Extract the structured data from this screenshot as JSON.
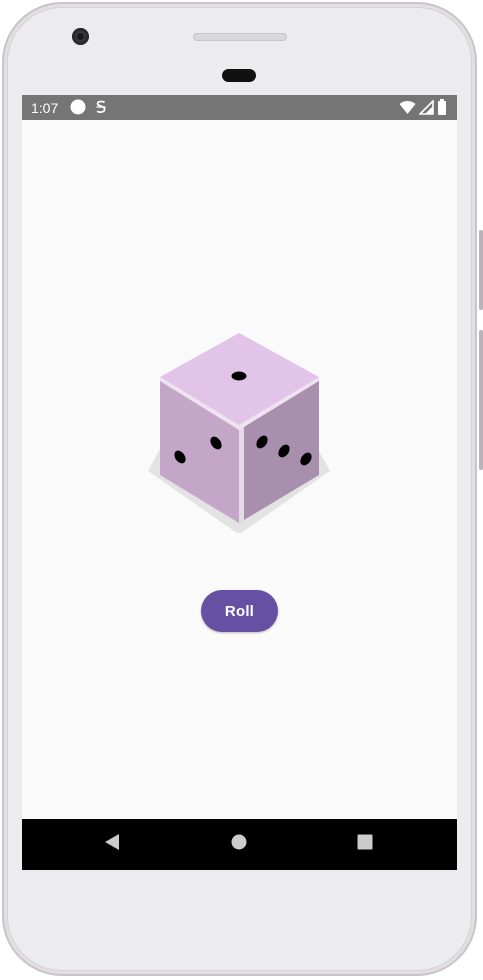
{
  "status_bar": {
    "time": "1:07",
    "left_icons": [
      "circle-notification-icon",
      "s-notification-icon"
    ],
    "right_icons": [
      "wifi-icon",
      "cellular-signal-icon",
      "battery-icon"
    ],
    "background": "#757575"
  },
  "app": {
    "background": "#fafafa",
    "dice": {
      "face_value_top": 1,
      "face_value_left": 2,
      "face_value_right": 3
    },
    "roll_button": {
      "label": "Roll",
      "color": "#6650a4"
    }
  },
  "nav_bar": {
    "buttons": [
      "back-icon",
      "home-icon",
      "recents-icon"
    ],
    "background": "#000000"
  }
}
